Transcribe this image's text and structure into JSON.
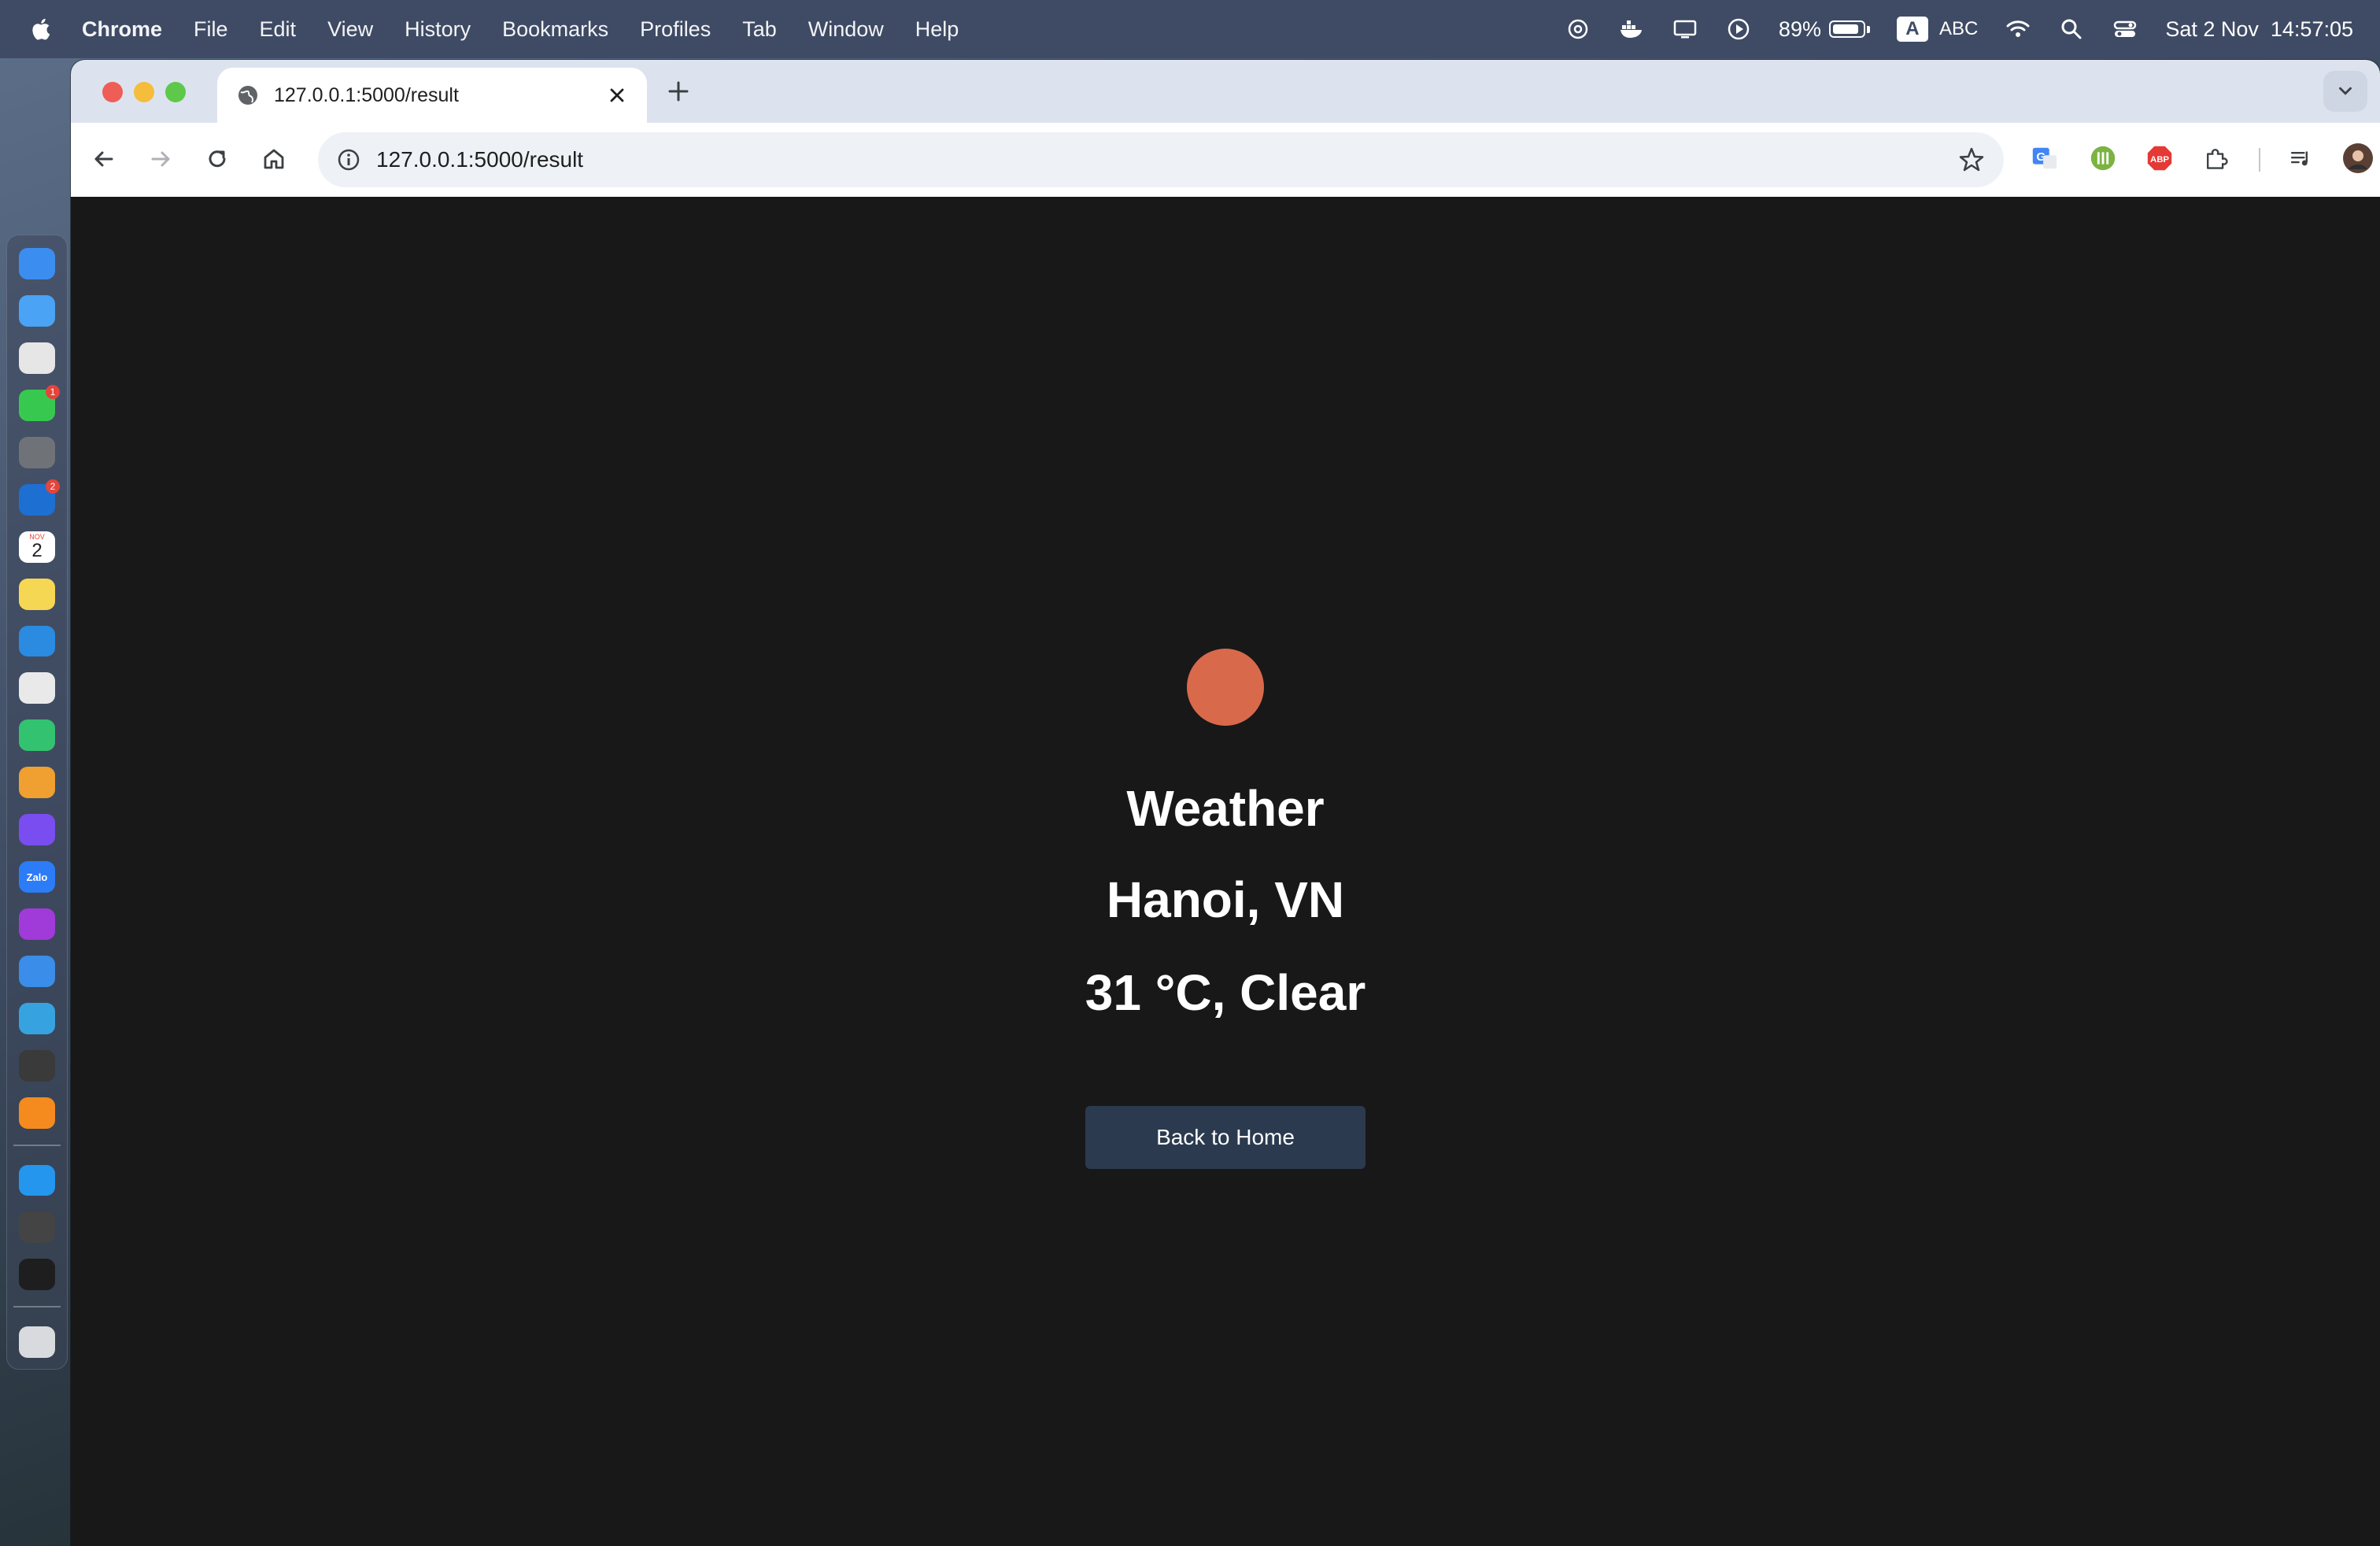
{
  "menubar": {
    "app_name": "Chrome",
    "menus": [
      "File",
      "Edit",
      "View",
      "History",
      "Bookmarks",
      "Profiles",
      "Tab",
      "Window",
      "Help"
    ],
    "battery_percent": "89%",
    "battery_level": 0.89,
    "input_source_badge": "A",
    "input_source_label": "ABC",
    "datetime": "Sat 2 Nov  14:57:05"
  },
  "browser": {
    "tab_title": "127.0.0.1:5000/result",
    "url": "127.0.0.1:5000/result"
  },
  "dock": {
    "apps": [
      {
        "name": "finder-icon",
        "color": "#3b8ef0"
      },
      {
        "name": "safari-icon",
        "color": "#4aa3f5"
      },
      {
        "name": "launchpad-icon",
        "color": "#e6e6e6"
      },
      {
        "name": "messages-icon",
        "color": "#37c94f",
        "badge": "1"
      },
      {
        "name": "system-settings-icon",
        "color": "#6f7378"
      },
      {
        "name": "outlook-icon",
        "color": "#1d6fd1",
        "badge": "2"
      },
      {
        "name": "calendar-icon",
        "color": "#ffffff"
      },
      {
        "name": "notes-icon",
        "color": "#f6d754"
      },
      {
        "name": "vscode-icon",
        "color": "#2a8be0"
      },
      {
        "name": "chrome-icon",
        "color": "#e9e9e9"
      },
      {
        "name": "shield-app-icon",
        "color": "#33c270"
      },
      {
        "name": "photos-icon",
        "color": "#f0a030"
      },
      {
        "name": "messenger-icon",
        "color": "#7a4df0"
      },
      {
        "name": "zalo-icon",
        "color": "#2b7cf6"
      },
      {
        "name": "podcasts-icon",
        "color": "#a03ad8"
      },
      {
        "name": "weather-app-icon",
        "color": "#3a8de8"
      },
      {
        "name": "telegram-icon",
        "color": "#36a3e0"
      },
      {
        "name": "chatgpt-icon",
        "color": "#3a3a3a"
      },
      {
        "name": "vlc-icon",
        "color": "#f58a1f"
      },
      {
        "name": "docker-icon",
        "color": "#2496ed"
      },
      {
        "name": "preview-icon",
        "color": "#444444"
      },
      {
        "name": "terminal-icon",
        "color": "#1e1e1e"
      },
      {
        "name": "trash-icon",
        "color": "#d8dadd"
      }
    ],
    "calendar_day": "2",
    "calendar_month": "NOV",
    "zalo_label": "Zalo"
  },
  "page": {
    "sun_color": "#d9694b",
    "heading": "Weather",
    "location": "Hanoi, VN",
    "conditions": "31 °C, Clear",
    "back_button_label": "Back to Home",
    "background_color": "#181818",
    "button_color": "#2b3a4f"
  }
}
